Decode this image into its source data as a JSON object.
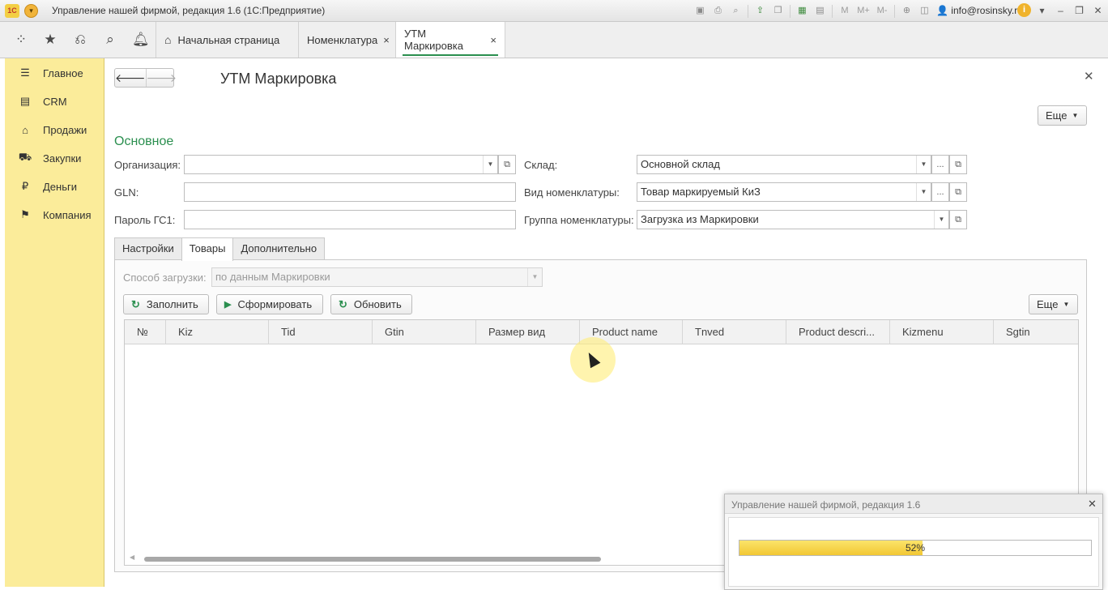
{
  "window": {
    "title": "Управление нашей фирмой, редакция 1.6  (1С:Предприятие)",
    "logo": "1С",
    "user": "info@rosinsky.ru",
    "memory_buttons": [
      "M",
      "M+",
      "M-"
    ]
  },
  "tabs": [
    {
      "label": "Начальная страница",
      "icon": "home-icon"
    },
    {
      "label": "Номенклатура",
      "close": "×"
    },
    {
      "label": "УТМ Маркировка",
      "close": "×",
      "active": true
    }
  ],
  "sidebar": {
    "items": [
      {
        "label": "Главное",
        "icon": "menu-icon"
      },
      {
        "label": "CRM",
        "icon": "contact-card-icon"
      },
      {
        "label": "Продажи",
        "icon": "basket-icon"
      },
      {
        "label": "Закупки",
        "icon": "cart-icon"
      },
      {
        "label": "Деньги",
        "icon": "ruble-icon"
      },
      {
        "label": "Компания",
        "icon": "flag-icon"
      }
    ]
  },
  "form": {
    "title": "УТМ Маркировка",
    "more_label": "Еще",
    "section": "Основное",
    "fields": {
      "organization_label": "Организация:",
      "organization_value": "",
      "gln_label": "GLN:",
      "gln_value": "",
      "password_label": "Пароль ГС1:",
      "password_value": "",
      "warehouse_label": "Склад:",
      "warehouse_value": "Основной склад",
      "kind_label": "Вид номенклатуры:",
      "kind_value": "Товар маркируемый КиЗ",
      "group_label": "Группа номенклатуры:",
      "group_value": "Загрузка из Маркировки"
    },
    "inner_tabs": [
      "Настройки",
      "Товары",
      "Дополнительно"
    ],
    "load_method_label": "Способ загрузки:",
    "load_method_value": "по данным Маркировки",
    "buttons": {
      "fill": "Заполнить",
      "generate": "Сформировать",
      "refresh": "Обновить",
      "more": "Еще"
    },
    "table_columns": [
      "№",
      "Kiz",
      "Tid",
      "Gtin",
      "Размер вид",
      "Product name",
      "Tnved",
      "Product descri...",
      "Kizmenu",
      "Sgtin"
    ]
  },
  "progress_dialog": {
    "title": "Управление нашей фирмой, редакция 1.6",
    "percent_text": "52%",
    "progress": 0.52
  },
  "colors": {
    "accent": "#2b8f4f",
    "sidebar_bg": "#fbec9a",
    "progress_fill": "#f2c733"
  }
}
